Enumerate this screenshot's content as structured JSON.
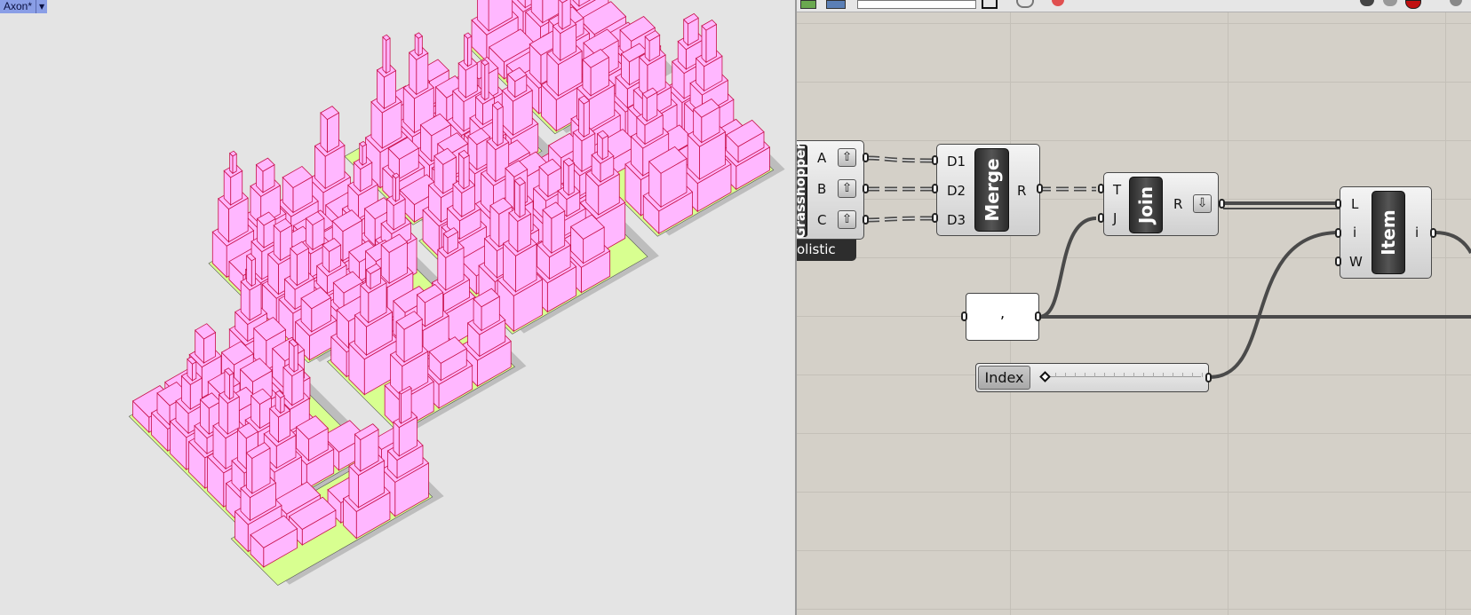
{
  "viewport": {
    "tab_label": "Axon*"
  },
  "grasshopper": {
    "cluster": {
      "ports": [
        "A",
        "B",
        "C"
      ],
      "footer": "olistic",
      "title": "Grasshopper"
    },
    "merge": {
      "title": "Merge",
      "inputs": [
        "D1",
        "D2",
        "D3"
      ],
      "output": "R"
    },
    "join": {
      "title": "Join",
      "inputs": [
        "T",
        "J"
      ],
      "output": "R"
    },
    "item": {
      "title": "Item",
      "inputs": [
        "L",
        "i",
        "W"
      ],
      "output": "i"
    },
    "panel": {
      "text": ","
    },
    "slider": {
      "label": "Index"
    }
  },
  "colors": {
    "building": "#ffb7ff",
    "edge": "#c8104a",
    "green": "#d8ff90",
    "canvas": "#d4d0c8"
  }
}
